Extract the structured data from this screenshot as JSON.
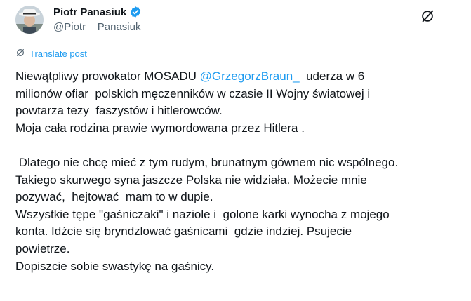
{
  "author": {
    "name": "Piotr Panasiuk",
    "handle": "@Piotr__Panasiuk"
  },
  "colors": {
    "accent": "#1d9bf0",
    "text": "#0f1419",
    "muted": "#536471"
  },
  "icons": {
    "verified": "verified-badge-icon",
    "more": "grok-slash-circle-icon",
    "translate": "translate-icon"
  },
  "translate_label": "Translate post",
  "post": {
    "line1_before": "Niewątpliwy prowokator MOSADU ",
    "mention": "@GrzegorzBraun_",
    "line1_after": "  uderza w 6",
    "line2": "milionów ofiar  polskich męczenników w czasie II Wojny światowej i",
    "line3": "powtarza tezy  faszystów i hitlerowców.",
    "line4": "Moja cała rodzina prawie wymordowana przez Hitlera .",
    "line5": "",
    "line6": " Dlatego nie chcę mieć z tym rudym, brunatnym gównem nic wspólnego.",
    "line7": "Takiego skurwego syna jaszcze Polska nie widziała. Możecie mnie",
    "line8": "pozywać,  hejtować  mam to w dupie.",
    "line9": "Wszystkie tępe \"gaśniczaki\" i naziole i  golone karki wynocha z mojego",
    "line10": "konta. Idźcie się bryndzlować gaśnicami  gdzie indziej. Psujecie",
    "line11": "powietrze.",
    "line12": "Dopiszcie sobie swastykę na gaśnicy."
  }
}
